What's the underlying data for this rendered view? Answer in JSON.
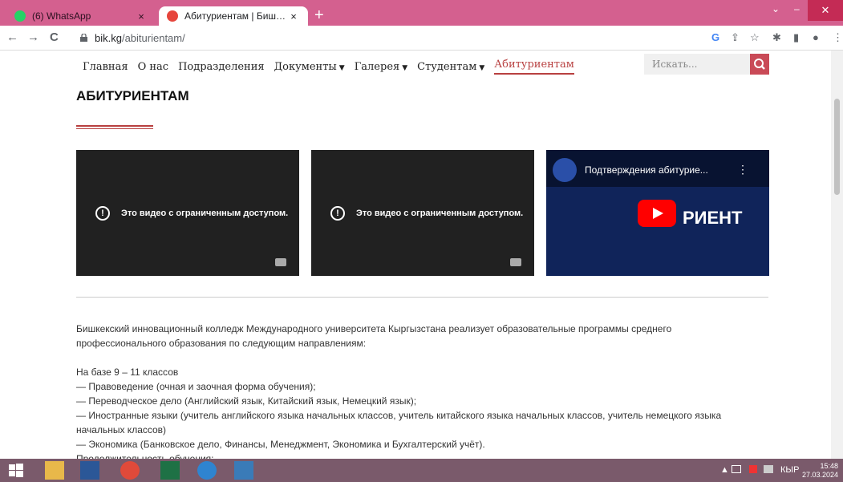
{
  "browser": {
    "tabs": [
      {
        "title": "(6) WhatsApp",
        "favicon_color": "#25d366"
      },
      {
        "title": "Абитуриентам | Бишкекский ин…",
        "favicon_color": "#e6453c"
      }
    ],
    "close_glyph": "×",
    "newtab_glyph": "+",
    "url_host": "bik.kg",
    "url_path": "/abiturientam/",
    "nav": {
      "back": "←",
      "forward": "→",
      "reload": "C"
    },
    "right_icons": {
      "google": "G",
      "share": "⇪",
      "star": "☆",
      "ext": "✱",
      "side": "▮",
      "profile": "●",
      "menu": "⋮"
    },
    "window": {
      "chevron": "⌄",
      "minimize": "–",
      "restore": "⧉",
      "close": "✕"
    }
  },
  "site": {
    "nav": [
      {
        "label": "Главная",
        "caret": ""
      },
      {
        "label": "О нас",
        "caret": ""
      },
      {
        "label": "Подразделения",
        "caret": ""
      },
      {
        "label": "Документы",
        "caret": "▼"
      },
      {
        "label": "Галерея",
        "caret": "▼"
      },
      {
        "label": "Студентам",
        "caret": "▼"
      },
      {
        "label": "Абитуриентам",
        "caret": ""
      }
    ],
    "search_placeholder": "Искать...",
    "heading": "АБИТУРИЕНТАМ",
    "videos": [
      {
        "message": "Это видео с ограниченным доступом.",
        "alert_glyph": "!"
      },
      {
        "message": "Это видео с ограниченным доступом.",
        "alert_glyph": "!"
      }
    ],
    "featured_video": {
      "title": "Подтверждения абитурие...",
      "brand": "РИЕНТ",
      "menu_glyph": "⋮"
    },
    "paragraph1_line1": "Бишкекский инновационный колледж Международного университета Кыргызстана реализует образовательные программы среднего",
    "paragraph1_line2": "профессионального образования по следующим направлениям:",
    "base_heading": "На базе 9 – 11 классов",
    "programs": [
      "— Правоведение (очная и заочная форма обучения);",
      "— Переводческое дело (Английский язык, Китайский язык, Немецкий язык);",
      "— Иностранные языки (учитель английского языка начальных классов, учитель китайского языка начальных классов, учитель немецкого языка",
      "начальных классов)",
      "— Экономика (Банковское дело, Финансы, Менеджмент, Экономика и Бухгалтерский учёт)."
    ],
    "cut_line": "Продолжительность обучения:"
  },
  "taskbar": {
    "lang": "КЫР",
    "time": "15:48",
    "date": "27.03.2024",
    "tray_arrow": "▲"
  }
}
